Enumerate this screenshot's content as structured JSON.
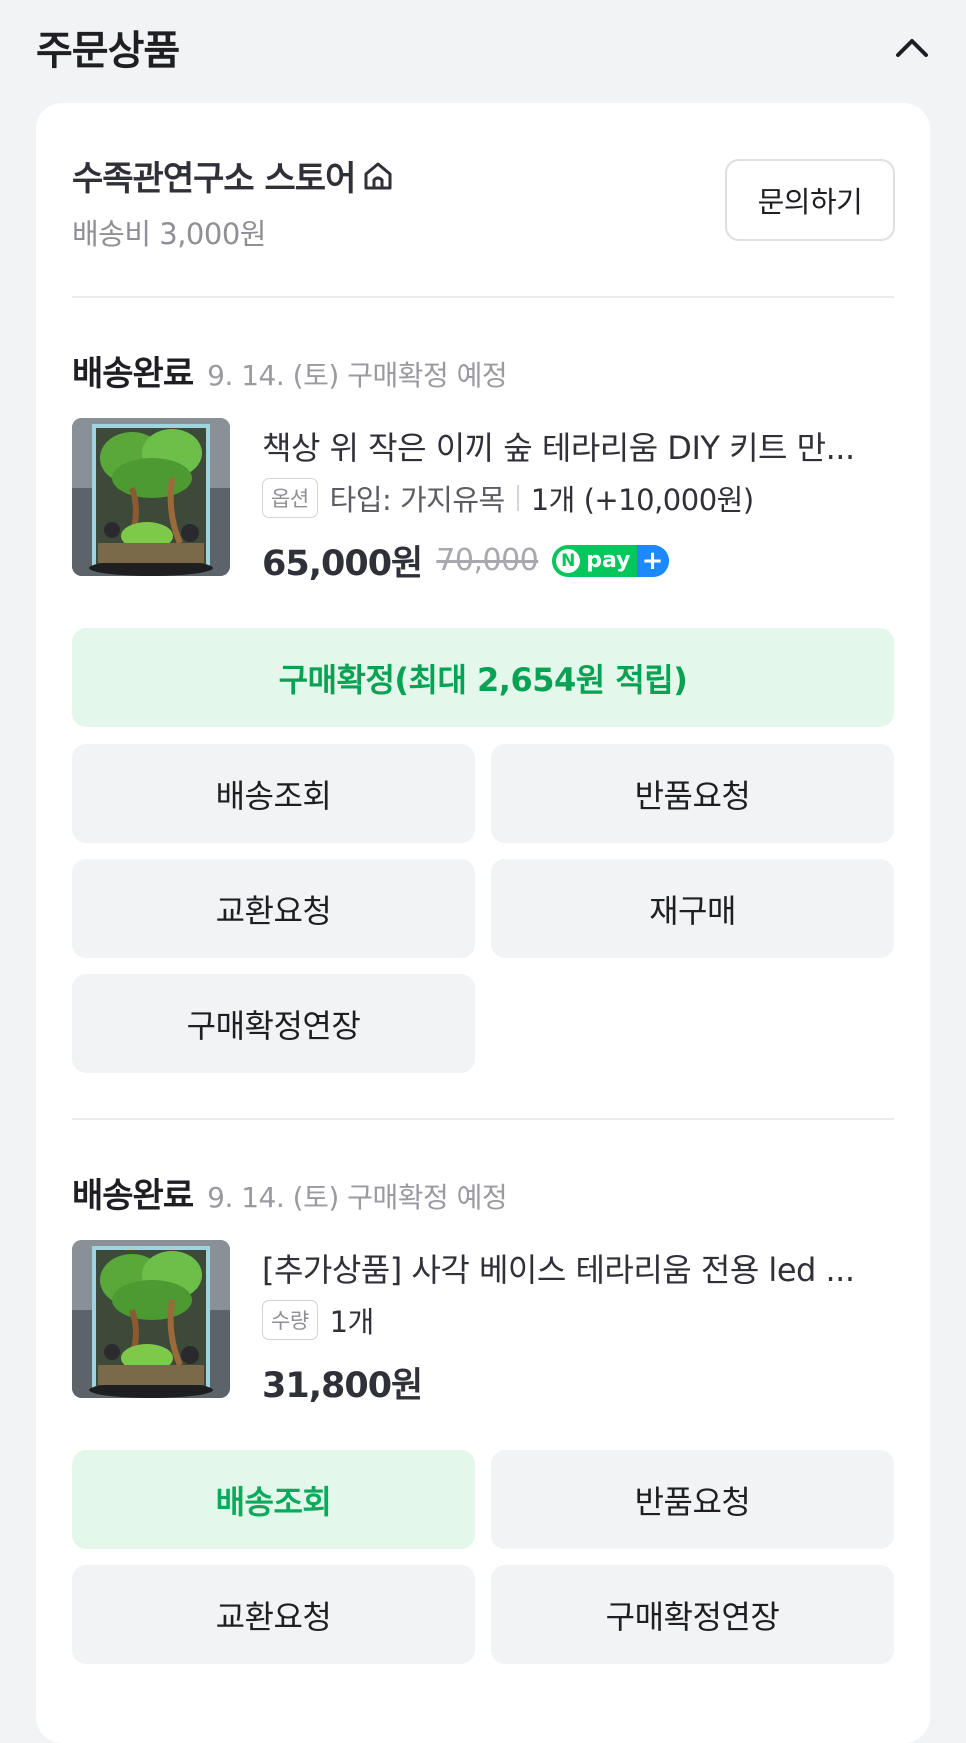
{
  "section": {
    "title": "주문상품",
    "collapse_icon": "chevron-up-icon"
  },
  "store": {
    "name": "수족관연구소 스토어",
    "home_icon": "store-home-icon",
    "shipping_fee": "배송비 3,000원",
    "inquiry_label": "문의하기"
  },
  "items": [
    {
      "status": "배송완료",
      "status_sub": "9. 14. (토) 구매확정 예정",
      "name": "책상 위 작은 이끼 숲 테라리움 DIY 키트 만...",
      "option_tag": "옵션",
      "option_text": "타입: 가지유목",
      "option_qty": "1개 (+10,000원)",
      "price": "65,000원",
      "original_price": "70,000",
      "npay": {
        "n": "N",
        "text": "pay",
        "plus": "+"
      },
      "actions": {
        "confirm": "구매확정(최대 2,654원 적립)",
        "tracking": "배송조회",
        "return": "반품요청",
        "exchange": "교환요청",
        "rebuy": "재구매",
        "extend": "구매확정연장"
      }
    },
    {
      "status": "배송완료",
      "status_sub": "9. 14. (토) 구매확정 예정",
      "name": "[추가상품] 사각 베이스 테라리움 전용 led ...",
      "option_tag": "수량",
      "option_qty": "1개",
      "price": "31,800원",
      "actions": {
        "tracking": "배송조회",
        "return": "반품요청",
        "exchange": "교환요청",
        "extend": "구매확정연장"
      }
    }
  ],
  "colors": {
    "accent_green": "#09aa5c",
    "accent_green_bg": "#e3f7ea",
    "npay_green": "#03c75a",
    "npay_blue": "#1e88ff",
    "background": "#f2f3f5"
  }
}
